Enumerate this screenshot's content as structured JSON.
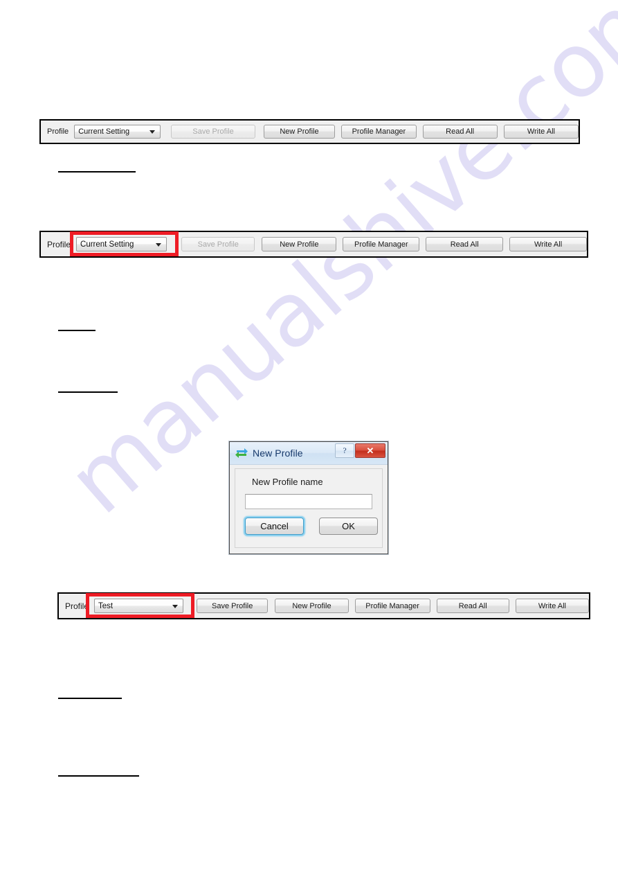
{
  "document": {
    "watermark": "manualshive.com"
  },
  "toolbars": [
    {
      "id": "toolbar-top",
      "label": "Profile",
      "combo": {
        "value": "Current Setting",
        "arrow_icon": "chevron-down-icon"
      },
      "buttons": [
        {
          "label": "Save Profile",
          "enabled": false
        },
        {
          "label": "New Profile",
          "enabled": true
        },
        {
          "label": "Profile Manager",
          "enabled": true
        },
        {
          "label": "Read All",
          "enabled": true
        },
        {
          "label": "Write All",
          "enabled": true
        }
      ],
      "highlight": false
    },
    {
      "id": "toolbar-middle",
      "label": "Profile",
      "combo": {
        "value": "Current Setting",
        "arrow_icon": "chevron-down-icon"
      },
      "buttons": [
        {
          "label": "Save Profile",
          "enabled": false
        },
        {
          "label": "New Profile",
          "enabled": true
        },
        {
          "label": "Profile Manager",
          "enabled": true
        },
        {
          "label": "Read All",
          "enabled": true
        },
        {
          "label": "Write All",
          "enabled": true
        }
      ],
      "highlight": true,
      "highlight_color": "#ee1c25"
    },
    {
      "id": "toolbar-bottom",
      "label": "Profile",
      "combo": {
        "value": "Test",
        "arrow_icon": "chevron-down-icon"
      },
      "buttons": [
        {
          "label": "Save Profile",
          "enabled": true
        },
        {
          "label": "New Profile",
          "enabled": true
        },
        {
          "label": "Profile Manager",
          "enabled": true
        },
        {
          "label": "Read All",
          "enabled": true
        },
        {
          "label": "Write All",
          "enabled": true
        }
      ],
      "highlight": true,
      "highlight_color": "#ee1c25"
    }
  ],
  "dialog": {
    "title": "New Profile",
    "title_icon": "sync-arrows-icon",
    "help_label": "?",
    "close_label": "✕",
    "field_label": "New Profile name",
    "field_value": "",
    "field_placeholder": "",
    "cancel_label": "Cancel",
    "ok_label": "OK",
    "focused_button": "Cancel"
  },
  "rules": [
    {
      "name": "rule-1"
    },
    {
      "name": "rule-2"
    },
    {
      "name": "rule-3"
    },
    {
      "name": "rule-4"
    },
    {
      "name": "rule-5"
    }
  ]
}
